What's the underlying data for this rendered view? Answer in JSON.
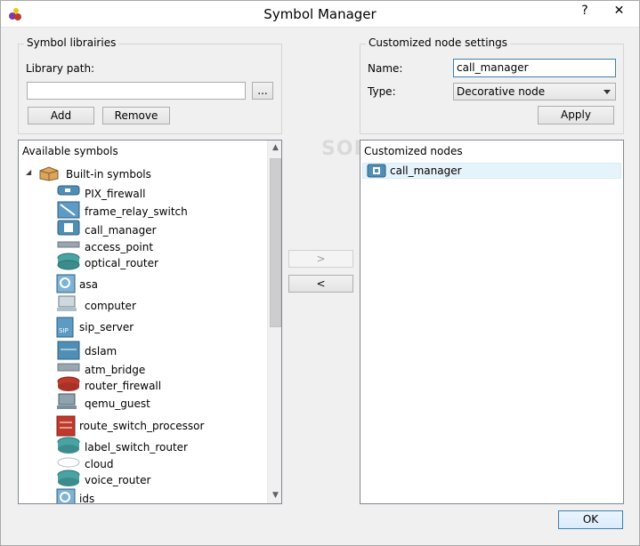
{
  "window": {
    "title": "Symbol Manager",
    "help_glyph": "?",
    "close_glyph": "✕"
  },
  "libraries": {
    "group_title": "Symbol librairies",
    "path_label": "Library path:",
    "path_value": "",
    "browse_label": "...",
    "add_label": "Add",
    "remove_label": "Remove"
  },
  "node_settings": {
    "group_title": "Customized node settings",
    "name_label": "Name:",
    "name_value": "call_manager",
    "type_label": "Type:",
    "type_value": "Decorative node",
    "apply_label": "Apply"
  },
  "available": {
    "header": "Available symbols",
    "root_label": "Built-in symbols",
    "expand_glyph": "◢",
    "items": [
      {
        "label": "PIX_firewall",
        "icon": "pix-firewall-icon"
      },
      {
        "label": "frame_relay_switch",
        "icon": "frame-relay-switch-icon"
      },
      {
        "label": "call_manager",
        "icon": "call-manager-icon"
      },
      {
        "label": "access_point",
        "icon": "access-point-icon"
      },
      {
        "label": "optical_router",
        "icon": "optical-router-icon"
      },
      {
        "label": "asa",
        "icon": "asa-icon"
      },
      {
        "label": "computer",
        "icon": "computer-icon"
      },
      {
        "label": "sip_server",
        "icon": "sip-server-icon"
      },
      {
        "label": "dslam",
        "icon": "dslam-icon"
      },
      {
        "label": "atm_bridge",
        "icon": "atm-bridge-icon"
      },
      {
        "label": "router_firewall",
        "icon": "router-firewall-icon"
      },
      {
        "label": "qemu_guest",
        "icon": "qemu-guest-icon"
      },
      {
        "label": "route_switch_processor",
        "icon": "route-switch-processor-icon"
      },
      {
        "label": "label_switch_router",
        "icon": "label-switch-router-icon"
      },
      {
        "label": "cloud",
        "icon": "cloud-icon"
      },
      {
        "label": "voice_router",
        "icon": "voice-router-icon"
      },
      {
        "label": "ids",
        "icon": "ids-icon"
      }
    ]
  },
  "transfer": {
    "add_label": ">",
    "remove_label": "<"
  },
  "customized": {
    "header": "Customized nodes",
    "items": [
      {
        "label": "call_manager",
        "icon": "call-manager-icon"
      }
    ]
  },
  "footer": {
    "ok_label": "OK"
  },
  "watermark": "SOFTPEDIA",
  "colors": {
    "accent": "#3c7fb1",
    "selection": "#e5f3fb",
    "router_blue": "#4f8fb5",
    "firewall_red": "#c0392b"
  }
}
